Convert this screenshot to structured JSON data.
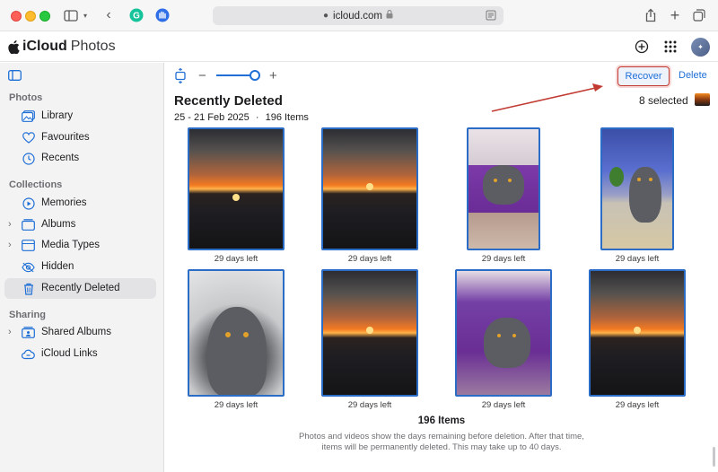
{
  "browser": {
    "url": "icloud.com"
  },
  "app": {
    "brand_name": "iCloud",
    "brand_suffix": "Photos"
  },
  "sidebar": {
    "sections": [
      {
        "title": "Photos",
        "items": [
          {
            "label": "Library",
            "icon": "photo-library-icon"
          },
          {
            "label": "Favourites",
            "icon": "heart-icon"
          },
          {
            "label": "Recents",
            "icon": "clock-icon"
          }
        ]
      },
      {
        "title": "Collections",
        "items": [
          {
            "label": "Memories",
            "icon": "memories-icon"
          },
          {
            "label": "Albums",
            "icon": "album-icon"
          },
          {
            "label": "Media Types",
            "icon": "media-types-icon"
          },
          {
            "label": "Hidden",
            "icon": "eye-slash-icon"
          },
          {
            "label": "Recently Deleted",
            "icon": "trash-icon",
            "active": true
          }
        ]
      },
      {
        "title": "Sharing",
        "items": [
          {
            "label": "Shared Albums",
            "icon": "shared-album-icon"
          },
          {
            "label": "iCloud Links",
            "icon": "link-icon"
          }
        ]
      }
    ]
  },
  "toolbar": {
    "zoom_level": 1.0,
    "recover_label": "Recover",
    "delete_label": "Delete"
  },
  "header": {
    "title": "Recently Deleted",
    "date_range": "25 - 21 Feb 2025",
    "separator": "·",
    "item_count": "196 Items",
    "selected_text": "8 selected"
  },
  "photos": [
    {
      "kind": "sunset",
      "caption": "29 days left"
    },
    {
      "kind": "sunset",
      "caption": "29 days left"
    },
    {
      "kind": "cat",
      "caption": "29 days left"
    },
    {
      "kind": "cat",
      "caption": "29 days left"
    },
    {
      "kind": "cat",
      "caption": "29 days left"
    },
    {
      "kind": "sunset",
      "caption": "29 days left"
    },
    {
      "kind": "cat",
      "caption": "29 days left"
    },
    {
      "kind": "sunset",
      "caption": "29 days left"
    }
  ],
  "footer": {
    "count": "196 Items",
    "note_line1": "Photos and videos show the days remaining before deletion. After that time,",
    "note_line2": "items will be permanently deleted. This may take up to 40 days."
  },
  "colors": {
    "accent": "#1f6fd6",
    "selection_border": "#2b6cc7",
    "annotation_red": "#c23b32"
  }
}
